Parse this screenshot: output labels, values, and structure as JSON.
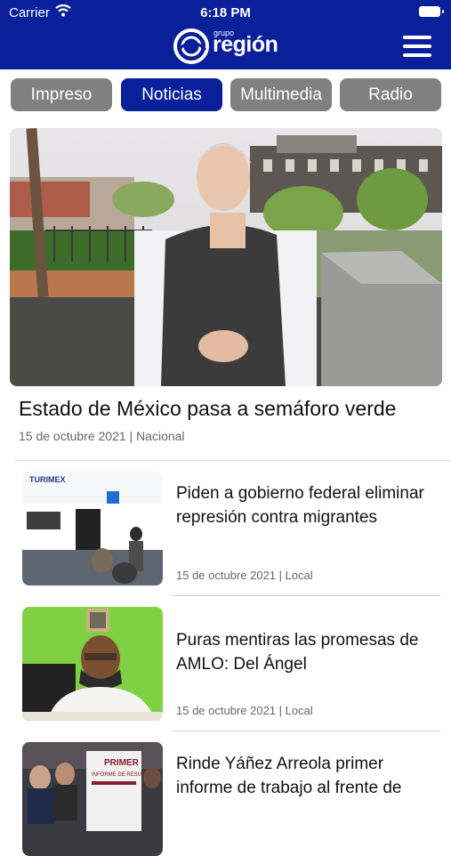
{
  "status": {
    "carrier": "Carrier",
    "time": "6:18 PM"
  },
  "logo": {
    "grupo": "grupo",
    "name": "región"
  },
  "tabs": [
    {
      "label": "Impreso",
      "active": false
    },
    {
      "label": "Noticias",
      "active": true
    },
    {
      "label": "Multimedia",
      "active": false
    },
    {
      "label": "Radio",
      "active": false
    }
  ],
  "featured": {
    "title": "Estado de México pasa a semáforo verde",
    "meta": "15 de octubre 2021 | Nacional"
  },
  "articles": [
    {
      "title": "Piden a gobierno federal eliminar represión contra migrantes",
      "meta": "15 de octubre 2021 | Local"
    },
    {
      "title": "Puras mentiras las promesas de AMLO: Del Ángel",
      "meta": "15 de octubre 2021 | Local"
    },
    {
      "title": "Rinde Yáñez Arreola primer informe de trabajo al frente de",
      "meta": ""
    }
  ],
  "thumb_texts": {
    "store_sign": "TURIMEX",
    "poster_title": "PRIMER",
    "poster_sub": "INFORME DE RESULTADOS"
  },
  "colors": {
    "brand": "#0a1f9a",
    "tab_inactive": "#808080",
    "meta_text": "#666666"
  },
  "icons": [
    "wifi-icon",
    "battery-icon",
    "logo-icon",
    "hamburger-menu-icon",
    "wheelchair-icon"
  ]
}
